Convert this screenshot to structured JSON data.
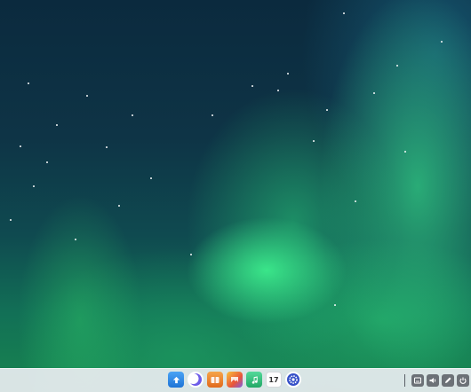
{
  "desktop": {
    "wallpaper": "aurora",
    "colors": {
      "sky_top": "#0b2a3e",
      "aurora_green": "#3ceb8c",
      "taskbar_bg": "#e8ecf0"
    }
  },
  "dock": {
    "apps": [
      {
        "name": "file-manager",
        "icon": "folder-icon",
        "color": "#2f8be6"
      },
      {
        "name": "launcher",
        "icon": "crescent-icon",
        "color": "#5b5ce0"
      },
      {
        "name": "app-store",
        "icon": "store-icon",
        "color": "#f08a2a"
      },
      {
        "name": "image-viewer",
        "icon": "photo-icon",
        "color": "#e8553a"
      },
      {
        "name": "music",
        "icon": "music-note-icon",
        "color": "#2ec27e"
      },
      {
        "name": "calendar",
        "icon": "calendar-icon",
        "day": "17"
      },
      {
        "name": "settings",
        "icon": "gear-icon",
        "color": "#3550c8"
      }
    ]
  },
  "tray": {
    "icons": [
      "keyboard-icon",
      "volume-icon",
      "pen-icon",
      "power-icon"
    ]
  }
}
